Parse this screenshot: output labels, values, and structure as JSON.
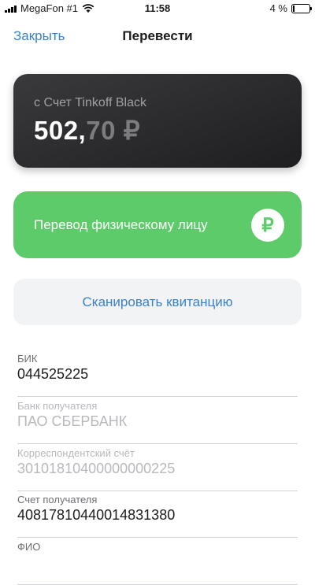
{
  "status_bar": {
    "carrier": "MegaFon #1",
    "time": "11:58",
    "battery": "4 %",
    "battery_level_fraction": 0.04
  },
  "nav": {
    "close_label": "Закрыть",
    "title": "Перевести"
  },
  "account": {
    "label": "с Счет Tinkoff Black",
    "amount_int": "502,",
    "amount_frac": "70",
    "currency": "₽"
  },
  "transfer": {
    "label": "Перевод физическому лицу",
    "icon": "ruble-icon",
    "icon_glyph": "₽"
  },
  "scan": {
    "label": "Сканировать квитанцию"
  },
  "fields": [
    {
      "label": "БИК",
      "value": "044525225"
    },
    {
      "label": "Банк получателя",
      "value": "ПАО СБЕРБАНК"
    },
    {
      "label": "Корреспондентский счёт",
      "value": "30101810400000000225"
    },
    {
      "label": "Счет получателя",
      "value": "40817810440014831380"
    },
    {
      "label": "ФИО",
      "value": ""
    }
  ],
  "colors": {
    "accent": "#3b82c8",
    "green": "#5ecb6a",
    "card_dark": "#2c2c2e"
  }
}
